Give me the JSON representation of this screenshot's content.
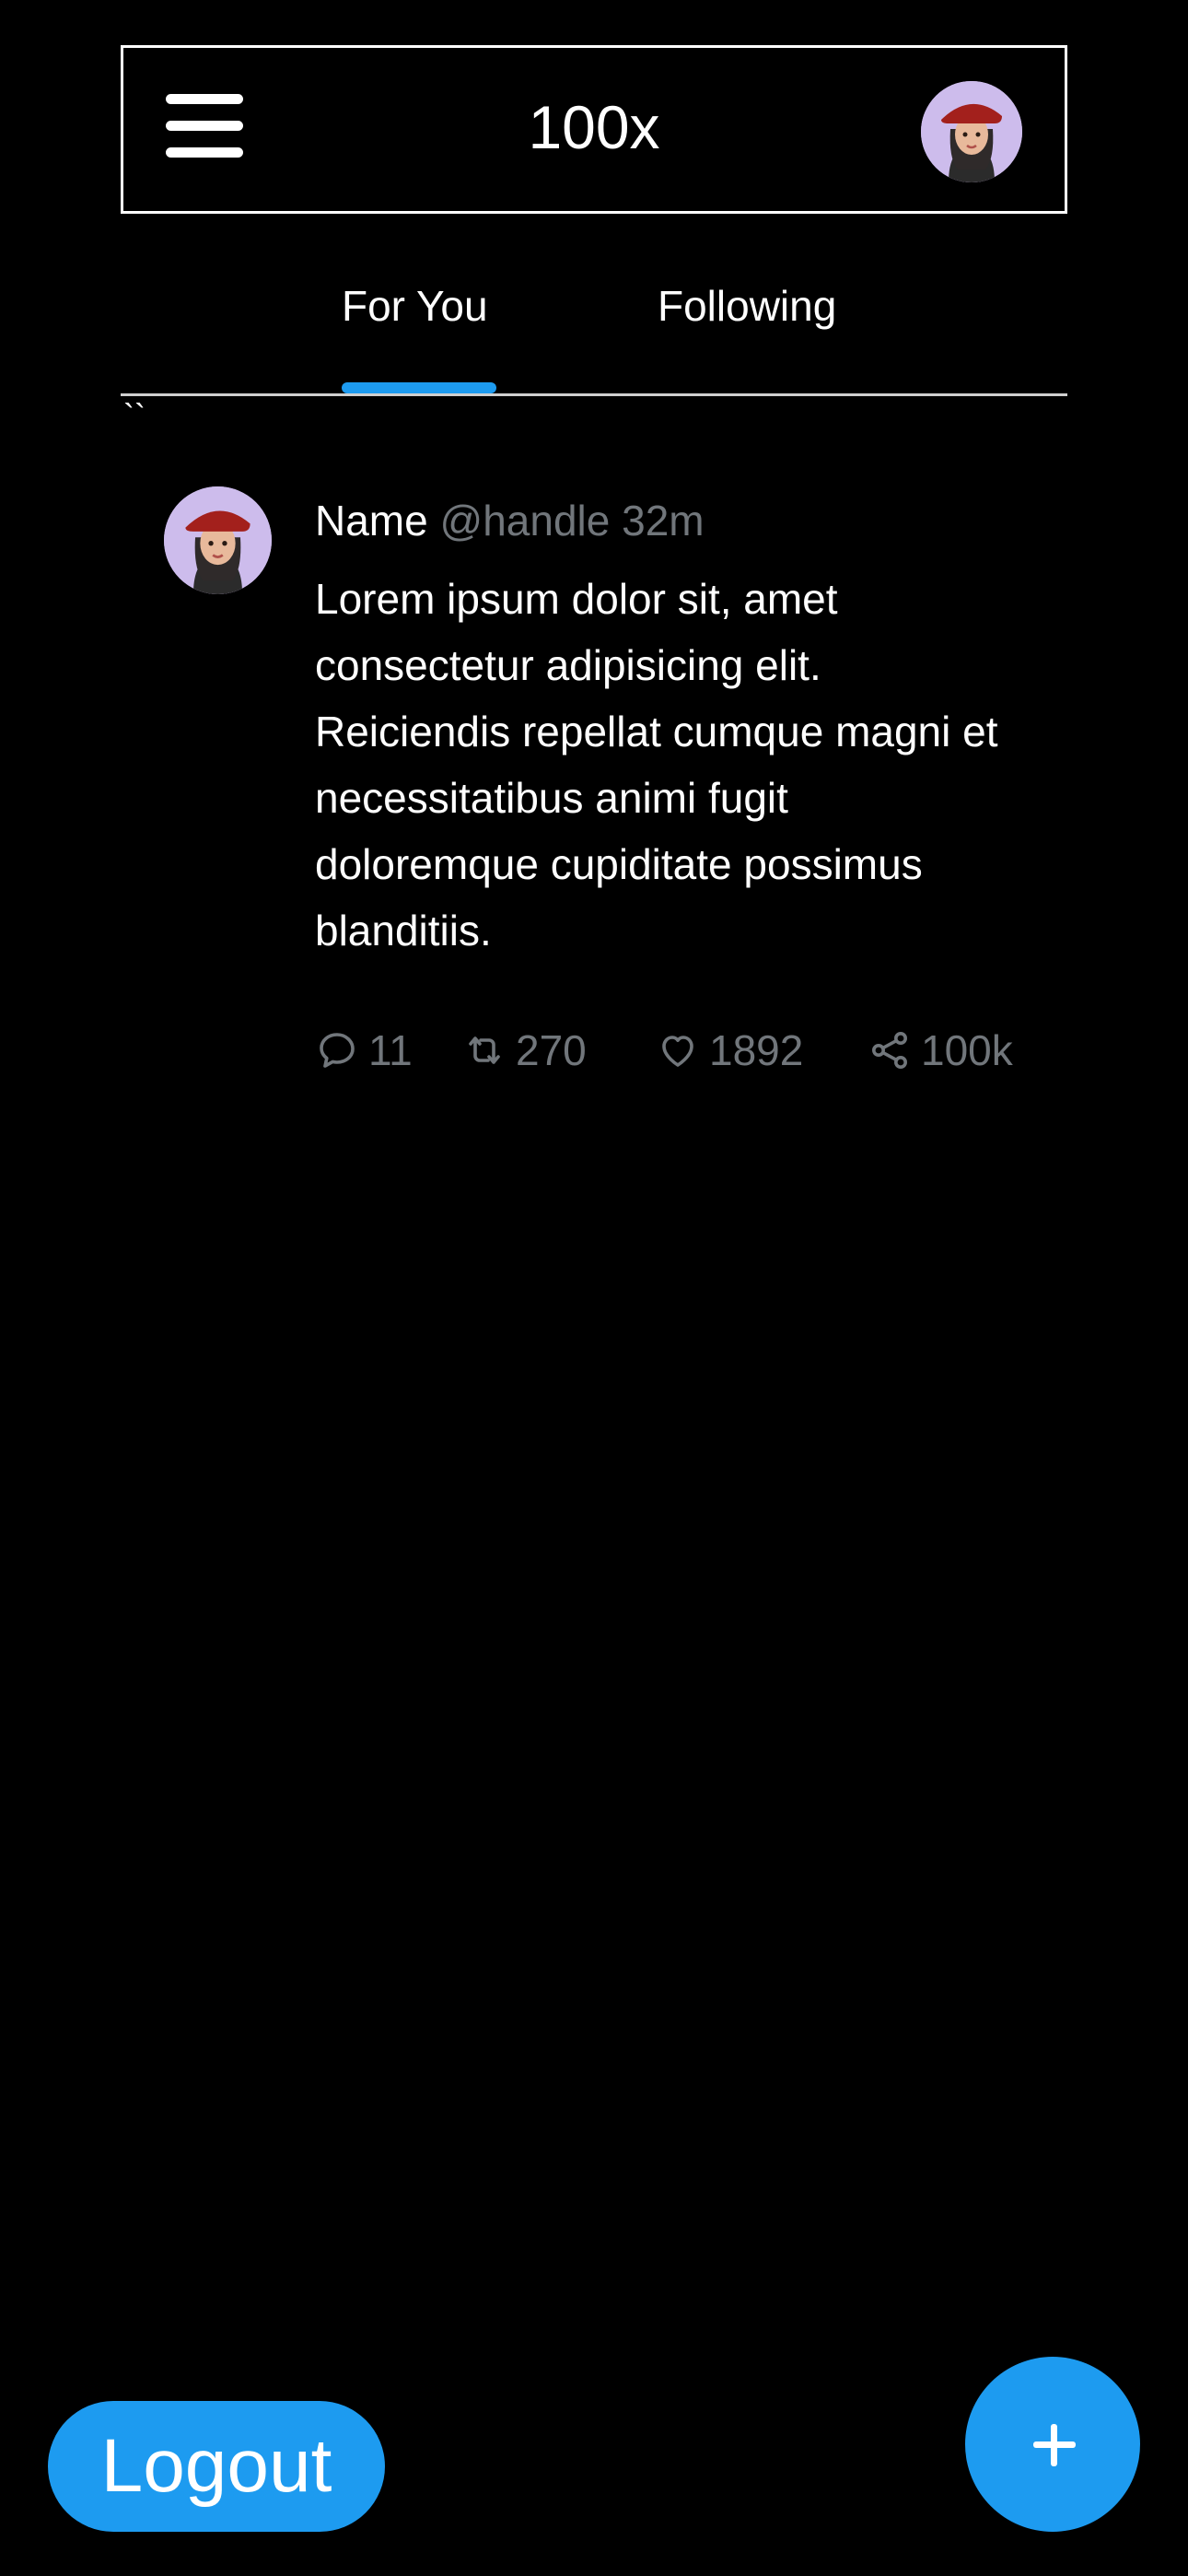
{
  "header": {
    "title": "100x",
    "menu_icon": "hamburger-menu-icon",
    "avatar_icon": "user-avatar"
  },
  "tabs": [
    {
      "label": "For You",
      "active": true
    },
    {
      "label": "Following",
      "active": false
    }
  ],
  "stray_text": "``",
  "post": {
    "name": "Name",
    "handle": "@handle",
    "time": "32m",
    "body": "Lorem ipsum dolor sit, amet consectetur adipisicing elit. Reiciendis repellat cumque magni et necessitatibus animi fugit doloremque cupiditate possimus blanditiis.",
    "actions": {
      "replies": "11",
      "reposts": "270",
      "likes": "1892",
      "shares": "100k"
    }
  },
  "bottom": {
    "logout_label": "Logout",
    "compose_icon": "plus-icon"
  },
  "colors": {
    "accent": "#1d9bf0",
    "muted": "#71767b",
    "background": "#000000"
  }
}
